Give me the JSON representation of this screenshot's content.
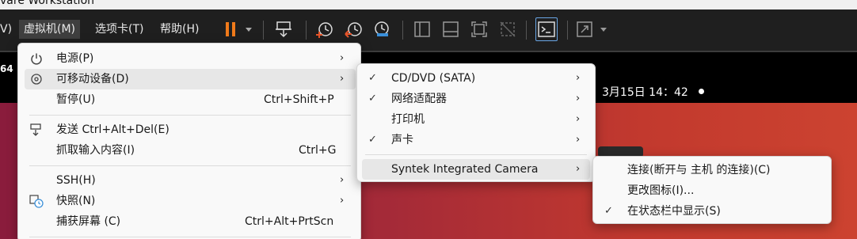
{
  "window": {
    "title_fragment": "vare Workstation"
  },
  "menubar": {
    "items": [
      {
        "label": "V)"
      },
      {
        "label": "虚拟机(M)"
      },
      {
        "label": "选项卡(T)"
      },
      {
        "label": "帮助(H)"
      }
    ]
  },
  "vm": {
    "label_fragment": "64",
    "clock": "3月15日  14：42"
  },
  "vm_menu": {
    "items": [
      {
        "label": "电源(P)",
        "shortcut": ""
      },
      {
        "label": "可移动设备(D)",
        "shortcut": ""
      },
      {
        "label": "暂停(U)",
        "shortcut": "Ctrl+Shift+P"
      },
      {
        "label": "发送 Ctrl+Alt+Del(E)",
        "shortcut": ""
      },
      {
        "label": "抓取输入内容(I)",
        "shortcut": "Ctrl+G"
      },
      {
        "label": "SSH(H)",
        "shortcut": ""
      },
      {
        "label": "快照(N)",
        "shortcut": ""
      },
      {
        "label": "捕获屏幕 (C)",
        "shortcut": "Ctrl+Alt+PrtScn"
      }
    ]
  },
  "removable_menu": {
    "items": [
      {
        "label": "CD/DVD (SATA)",
        "checked": true
      },
      {
        "label": "网络适配器",
        "checked": true
      },
      {
        "label": "打印机",
        "checked": false
      },
      {
        "label": "声卡",
        "checked": true
      },
      {
        "label": "Syntek Integrated Camera",
        "checked": false
      }
    ]
  },
  "camera_menu": {
    "items": [
      {
        "label": "连接(断开与 主机 的连接)(C)",
        "checked": false
      },
      {
        "label": "更改图标(I)...",
        "checked": false
      },
      {
        "label": "在状态栏中显示(S)",
        "checked": true
      }
    ]
  },
  "colors": {
    "pause_accent": "#f07a1a",
    "snapshot_accent_red": "#e8552a",
    "snapshot_accent_blue": "#3a8fd8",
    "desktop_red": "#a42a38"
  }
}
